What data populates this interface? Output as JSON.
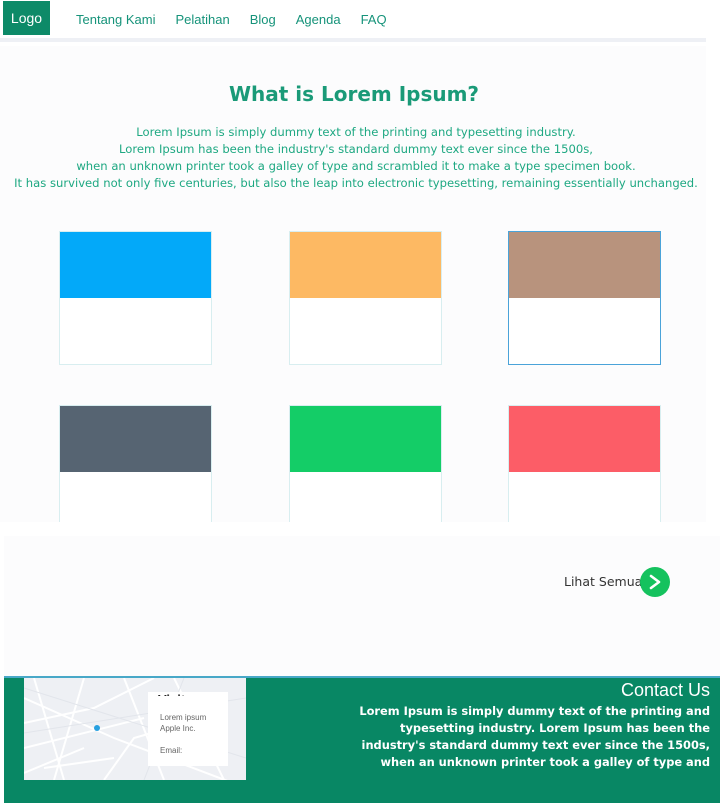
{
  "header": {
    "logo": "Logo",
    "nav": [
      "Tentang Kami",
      "Pelatihan",
      "Blog",
      "Agenda",
      "FAQ"
    ]
  },
  "main": {
    "title": "What is Lorem Ipsum?",
    "intro": [
      "Lorem Ipsum is simply dummy text of the printing and typesetting industry.",
      "Lorem Ipsum has been the industry's standard dummy text ever since the 1500s,",
      "when an unknown printer took a galley of type and scrambled it to make a type specimen book.",
      "It has survived not only five centuries, but also the leap into electronic typesetting, remaining essentially unchanged."
    ],
    "cards": [
      {
        "color": "#03a9f9"
      },
      {
        "color": "#fdb963"
      },
      {
        "color": "#b8937d"
      },
      {
        "color": "#566472"
      },
      {
        "color": "#14cd67"
      },
      {
        "color": "#fc5d67"
      }
    ]
  },
  "more": {
    "label": "Lihat Semua",
    "icon": "chevron-right-icon"
  },
  "footer": {
    "map": {
      "heading": "Visit",
      "lines": [
        "Lorem ipsum",
        "Apple Inc.",
        "",
        "Email:"
      ]
    },
    "contact_title": "Contact Us",
    "contact_text": "Lorem Ipsum is simply dummy text of the printing and typesetting industry. Lorem Ipsum has been the industry's standard dummy text ever since the 1500s, when an unknown printer took a galley of type and"
  },
  "colors": {
    "brand": "#0d8a68",
    "footer_bg": "#088764",
    "accent_green": "#15c25e"
  }
}
